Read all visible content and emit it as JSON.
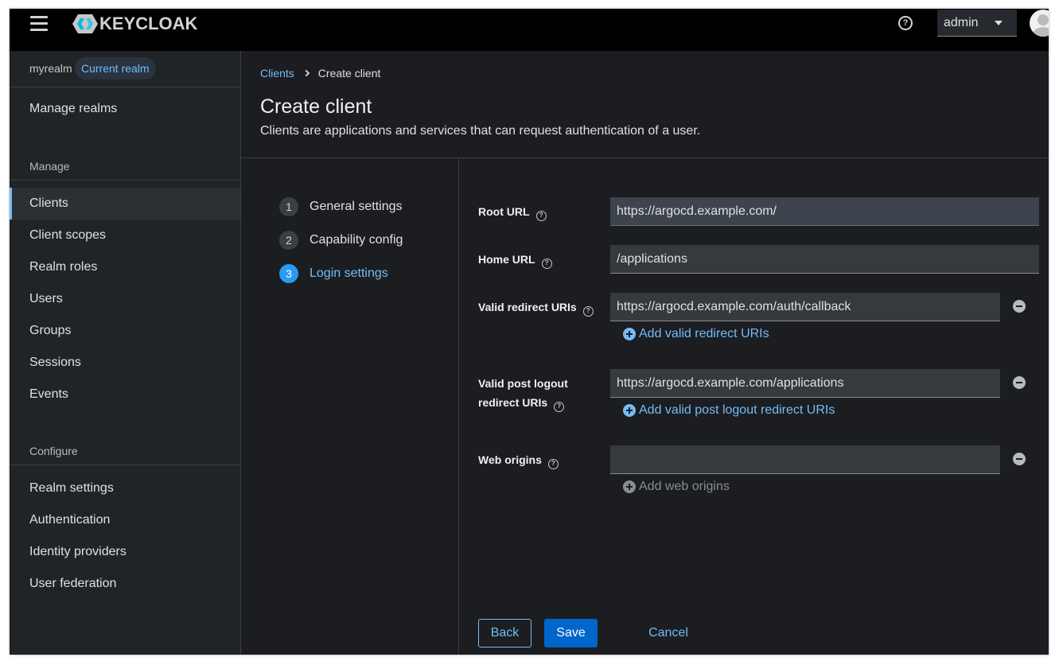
{
  "header": {
    "logo_text": "KEYCLOAK",
    "user_name": "admin",
    "help_symbol": "?"
  },
  "sidebar": {
    "realm_name": "myrealm",
    "realm_badge": "Current realm",
    "manage_realms": "Manage realms",
    "manage_section": "Manage",
    "manage_items": [
      {
        "label": "Clients",
        "active": true
      },
      {
        "label": "Client scopes"
      },
      {
        "label": "Realm roles"
      },
      {
        "label": "Users"
      },
      {
        "label": "Groups"
      },
      {
        "label": "Sessions"
      },
      {
        "label": "Events"
      }
    ],
    "configure_section": "Configure",
    "configure_items": [
      {
        "label": "Realm settings"
      },
      {
        "label": "Authentication"
      },
      {
        "label": "Identity providers"
      },
      {
        "label": "User federation"
      }
    ]
  },
  "breadcrumb": {
    "parent": "Clients",
    "current": "Create client"
  },
  "page": {
    "title": "Create client",
    "description": "Clients are applications and services that can request authentication of a user."
  },
  "wizard": {
    "steps": [
      {
        "num": "1",
        "label": "General settings"
      },
      {
        "num": "2",
        "label": "Capability config"
      },
      {
        "num": "3",
        "label": "Login settings",
        "current": true
      }
    ]
  },
  "form": {
    "root_url": {
      "label": "Root URL",
      "value": "https://argocd.example.com/"
    },
    "home_url": {
      "label": "Home URL",
      "value": "/applications"
    },
    "redirect_uris": {
      "label": "Valid redirect URIs",
      "value": "https://argocd.example.com/auth/callback",
      "add_label": "Add valid redirect URIs"
    },
    "post_logout": {
      "label_line1": "Valid post logout",
      "label_line2": "redirect URIs",
      "value": "https://argocd.example.com/applications",
      "add_label": "Add valid post logout redirect URIs"
    },
    "web_origins": {
      "label": "Web origins",
      "value": "",
      "add_label": "Add web origins"
    }
  },
  "buttons": {
    "back": "Back",
    "save": "Save",
    "cancel": "Cancel"
  },
  "colors": {
    "accent": "#73bcf7",
    "primary_button": "#0066cc",
    "background": "#1b1d21",
    "sidebar_bg": "#212427",
    "header_bg": "#000000"
  },
  "icons": {
    "menu": "hamburger-icon",
    "logo": "keycloak-logo-icon",
    "help": "help-icon",
    "user_dropdown": "caret-down-icon",
    "avatar": "user-avatar-icon",
    "remove": "minus-circle-icon",
    "add": "plus-circle-icon",
    "breadcrumb_separator": "chevron-right-icon"
  }
}
